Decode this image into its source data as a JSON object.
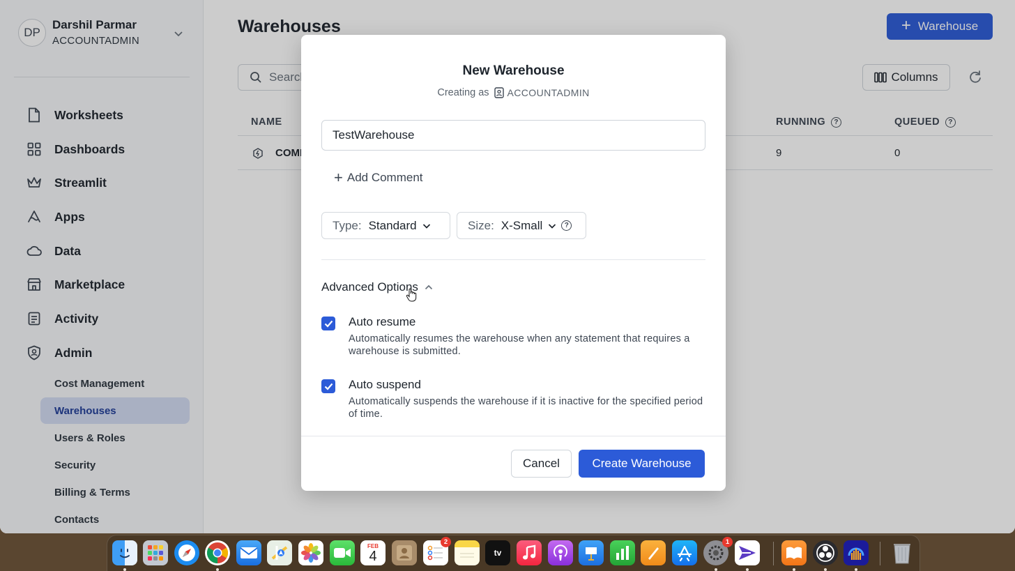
{
  "user": {
    "initials": "DP",
    "name": "Darshil Parmar",
    "role": "ACCOUNTADMIN"
  },
  "nav": [
    {
      "label": "Worksheets",
      "icon": "file-icon"
    },
    {
      "label": "Dashboards",
      "icon": "grid-icon"
    },
    {
      "label": "Streamlit",
      "icon": "crown-icon"
    },
    {
      "label": "Apps",
      "icon": "apps-icon"
    },
    {
      "label": "Data",
      "icon": "cloud-icon"
    },
    {
      "label": "Marketplace",
      "icon": "store-icon"
    },
    {
      "label": "Activity",
      "icon": "list-icon"
    },
    {
      "label": "Admin",
      "icon": "shield-icon"
    }
  ],
  "admin_sub": [
    {
      "label": "Cost Management",
      "active": false
    },
    {
      "label": "Warehouses",
      "active": true
    },
    {
      "label": "Users & Roles",
      "active": false
    },
    {
      "label": "Security",
      "active": false
    },
    {
      "label": "Billing & Terms",
      "active": false
    },
    {
      "label": "Contacts",
      "active": false
    }
  ],
  "main": {
    "title": "Warehouses",
    "new_button": "Warehouse",
    "search_placeholder": "Search",
    "columns_button": "Columns",
    "table": {
      "headers": {
        "name": "NAME",
        "running": "RUNNING",
        "queued": "QUEUED"
      },
      "row": {
        "name": "COMP",
        "running": "9",
        "queued": "0"
      }
    }
  },
  "modal": {
    "title": "New Warehouse",
    "creating_as": "Creating as",
    "role": "ACCOUNTADMIN",
    "name_value": "TestWarehouse",
    "add_comment": "Add Comment",
    "type_label": "Type:",
    "type_value": "Standard",
    "size_label": "Size:",
    "size_value": "X-Small",
    "advanced": "Advanced Options",
    "auto_resume": {
      "title": "Auto resume",
      "desc": "Automatically resumes the warehouse when any statement that requires a warehouse is submitted.",
      "checked": true
    },
    "auto_suspend": {
      "title": "Auto suspend",
      "desc": "Automatically suspends the warehouse if it is inactive for the specified period of time.",
      "checked": true
    },
    "cancel": "Cancel",
    "create": "Create Warehouse"
  },
  "dock": {
    "calendar_month": "FEB",
    "calendar_day": "4",
    "reminders_badge": "2",
    "settings_badge": "1",
    "apple_tv_label": "tv"
  },
  "colors": {
    "accent": "#2c5bd8",
    "active_nav_bg": "#d3dcf2",
    "active_nav_text": "#1f3d99"
  }
}
